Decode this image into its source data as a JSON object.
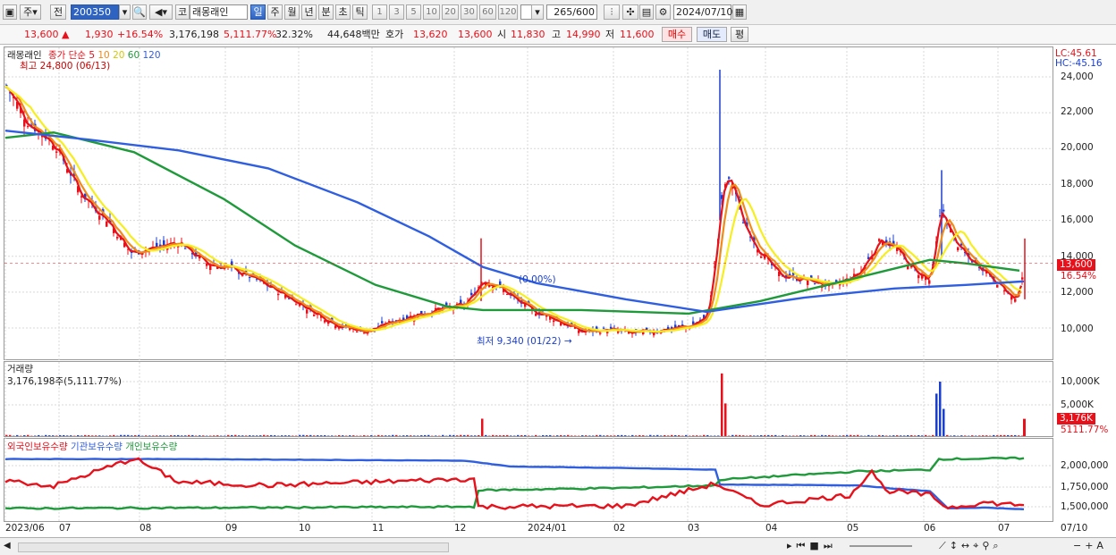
{
  "toolbar": {
    "period_unit": "주",
    "stock_code": "200350",
    "market_badge": "코",
    "stock_name": "래몽래인",
    "period_day": "일",
    "period_week": "주",
    "period_month": "월",
    "period_year": "년",
    "period_min": "분",
    "period_sec": "초",
    "period_tick": "틱",
    "intervals": [
      "1",
      "3",
      "5",
      "10",
      "20",
      "30",
      "60",
      "120"
    ],
    "count_value": "265",
    "count_total": "/600",
    "date": "2024/07/10",
    "prev_label": "전"
  },
  "info": {
    "price": "13,600",
    "change": "1,930",
    "change_pct": "+16.54%",
    "volume": "3,176,198",
    "volume_ratio": "5,111.77%",
    "turnover": "32.32%",
    "amount": "44,648백만",
    "quote_label": "호가",
    "ask": "13,620",
    "bid": "13,600",
    "open_label": "시",
    "open": "11,830",
    "high_label": "고",
    "high": "14,990",
    "low_label": "저",
    "low": "11,600",
    "buy_button": "매수",
    "sell_button": "매도",
    "eval_button": "평"
  },
  "price_pane": {
    "title": "래몽래인",
    "legend_label": "종가 단순",
    "ma_periods": [
      "5",
      "10",
      "20",
      "60",
      "120"
    ],
    "high_marker": "최고 24,800 (06/13)",
    "low_marker": "최저 9,340 (01/22)",
    "mid_marker": "(0.00%)",
    "lc": "LC:45.61",
    "hc": "HC:-45.16",
    "y_ticks": [
      "24,000",
      "22,000",
      "20,000",
      "18,000",
      "16,000",
      "14,000",
      "12,000",
      "10,000"
    ],
    "current_price_tag": "13,600",
    "current_pct_tag": "16.54%"
  },
  "volume_pane": {
    "title": "거래량",
    "value_text": "3,176,198주(5,111.77%)",
    "y_ticks": [
      "10,000K",
      "5,000K"
    ],
    "current_tag": "3,176K",
    "current_pct": "5111.77%"
  },
  "holdings_pane": {
    "legend": [
      "외국인보유수량",
      "기관보유수량",
      "개인보유수량"
    ],
    "y_ticks": [
      "2,000,000",
      "1,750,000",
      "1,500,000"
    ]
  },
  "x_axis": [
    "2023/06",
    "07",
    "08",
    "09",
    "10",
    "11",
    "12",
    "2024/01",
    "02",
    "03",
    "04",
    "05",
    "06",
    "07",
    "07/10"
  ],
  "colors": {
    "up": "#e8101a",
    "down": "#1a3fd0",
    "ma5": "#e8101a",
    "ma10": "#f08a18",
    "ma20": "#f7ee1e",
    "ma60": "#1e9a3a",
    "ma120": "#2f5fe0",
    "selected": "#2f63c2"
  },
  "chart_data": {
    "type": "line",
    "title": "래몽래인",
    "x": [
      "2023/06",
      "07",
      "08",
      "09",
      "10",
      "11",
      "12",
      "2024/01",
      "02",
      "03",
      "04",
      "05",
      "06",
      "07"
    ],
    "series": [
      {
        "name": "종가",
        "values": [
          22500,
          19800,
          15000,
          14000,
          12500,
          9900,
          12000,
          10400,
          9900,
          17000,
          13000,
          13500,
          14500,
          13600
        ]
      },
      {
        "name": "거래량",
        "values": [
          150000,
          90000,
          80000,
          70000,
          60000,
          90000,
          3200000,
          120000,
          70000,
          11500000,
          300000,
          250000,
          10000000,
          3176198
        ]
      }
    ],
    "ylim": [
      9000,
      25000
    ],
    "annotations": [
      "최고 24,800 (06/13)",
      "최저 9,340 (01/22)"
    ]
  }
}
